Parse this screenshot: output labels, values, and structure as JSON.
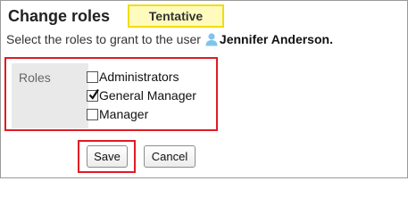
{
  "header": {
    "title": "Change roles",
    "badge": "Tentative"
  },
  "instruction": {
    "text": "Select the roles to grant to the user",
    "user_icon": "user-icon",
    "user_name": "Jennifer Anderson."
  },
  "roles": {
    "label": "Roles",
    "items": [
      {
        "label": "Administrators",
        "checked": false
      },
      {
        "label": "General Manager",
        "checked": true
      },
      {
        "label": "Manager",
        "checked": false
      }
    ]
  },
  "actions": {
    "save_label": "Save",
    "cancel_label": "Cancel"
  },
  "colors": {
    "highlight": "#e01b24",
    "badge_bg": "#fffbbd",
    "badge_border": "#f2dc10",
    "label_cell_bg": "#e9e9e9"
  }
}
